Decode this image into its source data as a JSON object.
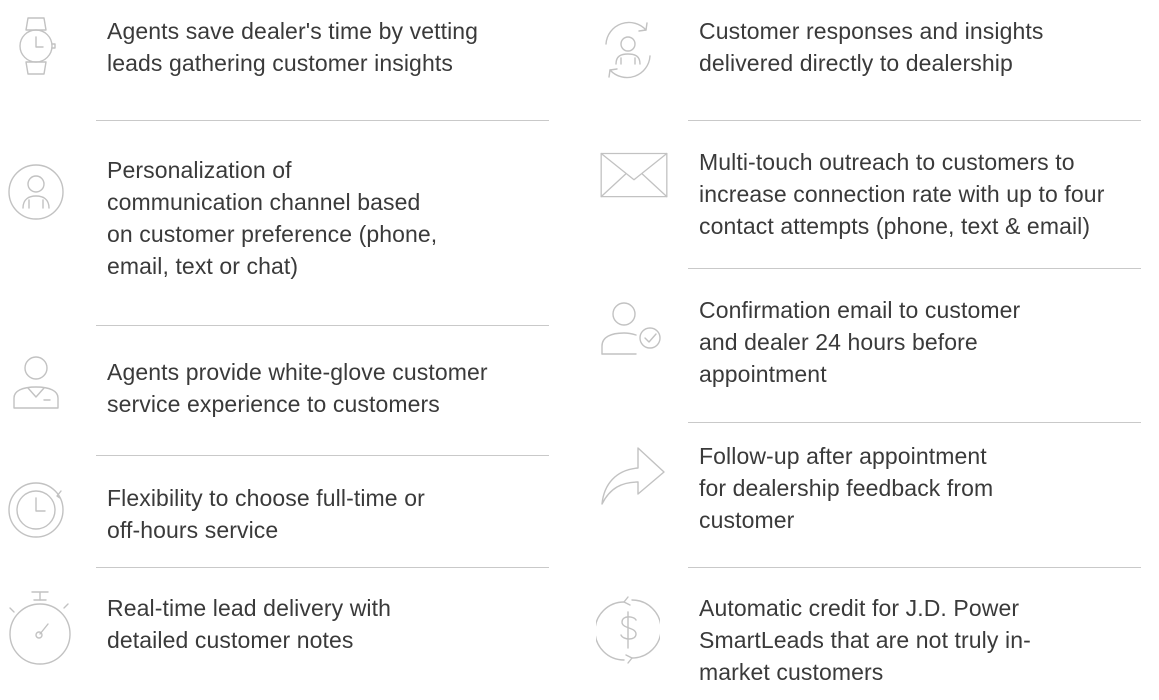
{
  "left_column": [
    {
      "icon": "watch-icon",
      "text": "Agents save dealer's time by vetting\nleads gathering customer insights"
    },
    {
      "icon": "user-circle-icon",
      "text": "Personalization of\ncommunication channel based\non customer preference (phone,\nemail, text or chat)"
    },
    {
      "icon": "agent-icon",
      "text": "Agents provide white-glove customer\nservice experience to customers"
    },
    {
      "icon": "clock-icon",
      "text": "Flexibility to choose full-time or\noff-hours service"
    },
    {
      "icon": "stopwatch-icon",
      "text": "Real-time lead delivery with\ndetailed customer notes"
    }
  ],
  "right_column": [
    {
      "icon": "user-sync-icon",
      "text": "Customer responses and insights\ndelivered directly to dealership"
    },
    {
      "icon": "envelope-icon",
      "text": "Multi-touch outreach to customers to\nincrease connection rate with up to four\ncontact attempts (phone, text & email)"
    },
    {
      "icon": "user-check-icon",
      "text": "Confirmation email to customer\nand dealer 24 hours before\nappointment"
    },
    {
      "icon": "share-arrow-icon",
      "text": "Follow-up after appointment\nfor dealership feedback from\ncustomer"
    },
    {
      "icon": "dollar-refresh-icon",
      "text": "Automatic credit for J.D. Power\nSmartLeads that are not truly in-\nmarket customers"
    }
  ]
}
